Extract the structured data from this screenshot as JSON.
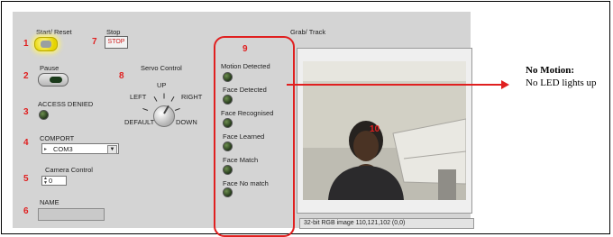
{
  "callout_numbers": [
    "1",
    "2",
    "3",
    "4",
    "5",
    "6",
    "7",
    "8",
    "9",
    "10"
  ],
  "controls": {
    "start_reset_label": "Start/ Reset",
    "stop_label": "Stop",
    "stop_button_text": "STOP",
    "pause_label": "Pause",
    "access_status_label": "ACCESS DENIED",
    "comport_label": "COMPORT",
    "comport_value": "COM3",
    "camera_control_label": "Camera Control",
    "camera_control_value": "0",
    "name_label": "NAME",
    "name_value": ""
  },
  "servo": {
    "title": "Servo Control",
    "up": "UP",
    "left": "LEFT",
    "right": "RIGHT",
    "default": "DEFAULT",
    "down": "DOWN"
  },
  "indicators": [
    {
      "label": "Motion Detected"
    },
    {
      "label": "Face Detected"
    },
    {
      "label": "Face Recognised"
    },
    {
      "label": "Face Learned"
    },
    {
      "label": "Face Match"
    },
    {
      "label": "Face No match"
    }
  ],
  "display": {
    "title": "Grab/ Track",
    "status": "32-bit RGB image 110,121,102    (0,0)"
  },
  "annotation": {
    "title": "No Motion:",
    "text": "No LED lights up"
  },
  "colors": {
    "annotation_red": "#e02020",
    "panel_gray": "#d4d4d4",
    "led_off": "#2f4a22"
  }
}
